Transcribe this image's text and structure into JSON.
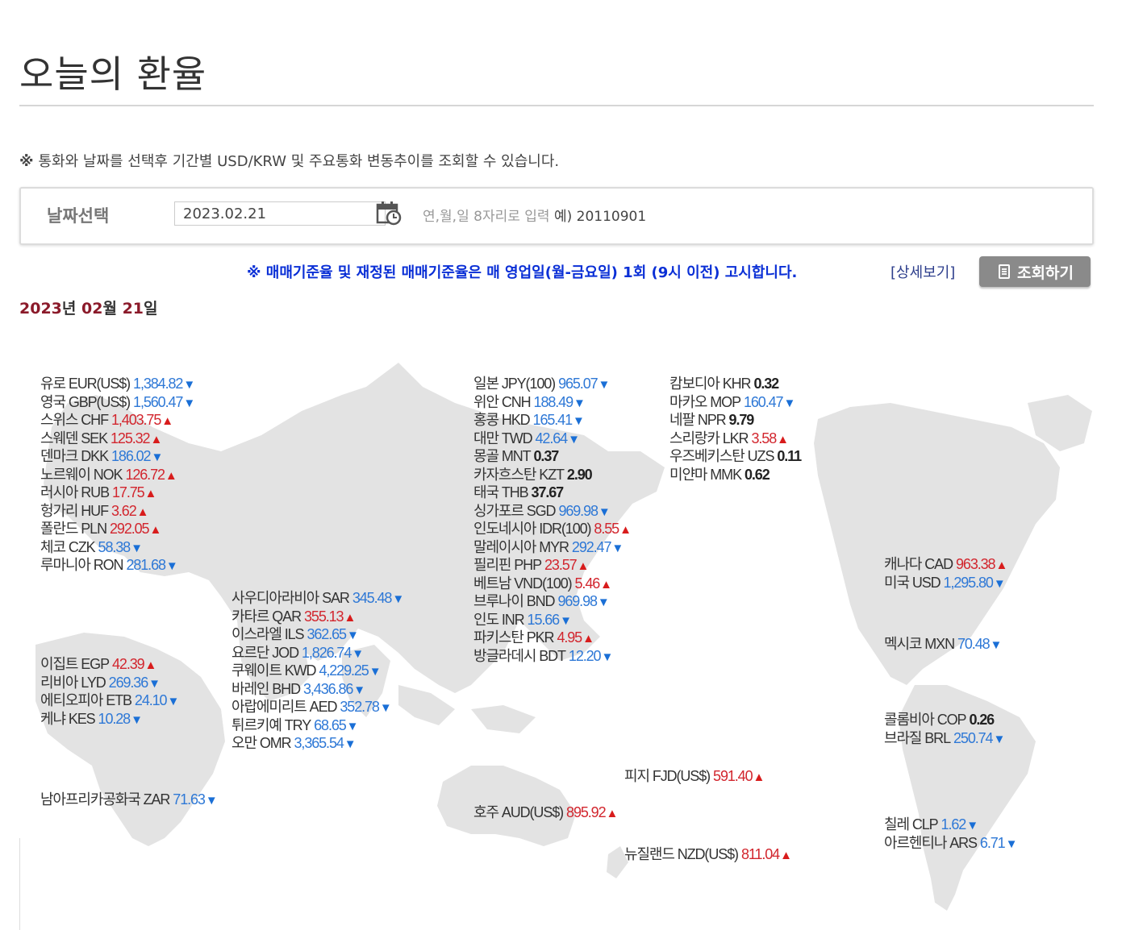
{
  "page": {
    "title": "오늘의 환율",
    "notice_mark": "※",
    "notice": "통화와 날짜를 선택후 기간별 USD/KRW 및 주요통화 변동추이를 조회할 수 있습니다.",
    "date_label": "날짜선택",
    "date_value": "2023.02.21",
    "date_hint": "연,월,일 8자리로 입력",
    "date_hint_example": "예) 20110901",
    "info": "※ 매매기준율 및 재정된 매매기준율은 매 영업일(월-금요일) 1회 (9시 이전) 고시합니다.",
    "detail_link": "[상세보기]",
    "query_button": "조회하기",
    "heading": {
      "year": "2023",
      "y_suffix": "년 ",
      "month": "02",
      "m_suffix": "월 ",
      "day": "21",
      "d_suffix": "일"
    }
  },
  "colors": {
    "up": "#d2262e",
    "down": "#2e78d6",
    "map": "#e3e3e3",
    "heading_num": "#8b1a2a"
  },
  "rates": [
    {
      "label": "유로 EUR(US$)",
      "value": "1,384.82",
      "dir": "down"
    },
    {
      "label": "영국 GBP(US$)",
      "value": "1,560.47",
      "dir": "down"
    },
    {
      "label": "스위스 CHF",
      "value": "1,403.75",
      "dir": "up"
    },
    {
      "label": "스웨덴 SEK",
      "value": "125.32",
      "dir": "up"
    },
    {
      "label": "덴마크 DKK",
      "value": "186.02",
      "dir": "down"
    },
    {
      "label": "노르웨이 NOK",
      "value": "126.72",
      "dir": "up"
    },
    {
      "label": "러시아 RUB",
      "value": "17.75",
      "dir": "up"
    },
    {
      "label": "헝가리 HUF",
      "value": "3.62",
      "dir": "up"
    },
    {
      "label": "폴란드 PLN",
      "value": "292.05",
      "dir": "up"
    },
    {
      "label": "체코 CZK",
      "value": "58.38",
      "dir": "down"
    },
    {
      "label": "루마니아 RON",
      "value": "281.68",
      "dir": "down"
    },
    {
      "label": "이집트 EGP",
      "value": "42.39",
      "dir": "up"
    },
    {
      "label": "리비아 LYD",
      "value": "269.36",
      "dir": "down"
    },
    {
      "label": "에티오피아 ETB",
      "value": "24.10",
      "dir": "down"
    },
    {
      "label": "케냐 KES",
      "value": "10.28",
      "dir": "down"
    },
    {
      "label": "남아프리카공화국 ZAR",
      "value": "71.63",
      "dir": "down"
    },
    {
      "label": "사우디아라비아 SAR",
      "value": "345.48",
      "dir": "down"
    },
    {
      "label": "카타르 QAR",
      "value": "355.13",
      "dir": "up"
    },
    {
      "label": "이스라엘 ILS",
      "value": "362.65",
      "dir": "down"
    },
    {
      "label": "요르단 JOD",
      "value": "1,826.74",
      "dir": "down"
    },
    {
      "label": "쿠웨이트 KWD",
      "value": "4,229.25",
      "dir": "down"
    },
    {
      "label": "바레인 BHD",
      "value": "3,436.86",
      "dir": "down"
    },
    {
      "label": "아랍에미리트 AED",
      "value": "352.78",
      "dir": "down"
    },
    {
      "label": "튀르키예 TRY",
      "value": "68.65",
      "dir": "down"
    },
    {
      "label": "오만 OMR",
      "value": "3,365.54",
      "dir": "down"
    },
    {
      "label": "일본 JPY(100)",
      "value": "965.07",
      "dir": "down"
    },
    {
      "label": "위안 CNH",
      "value": "188.49",
      "dir": "down"
    },
    {
      "label": "홍콩 HKD",
      "value": "165.41",
      "dir": "down"
    },
    {
      "label": "대만 TWD",
      "value": "42.64",
      "dir": "down"
    },
    {
      "label": "몽골 MNT",
      "value": "0.37",
      "dir": "flat"
    },
    {
      "label": "카자흐스탄 KZT",
      "value": "2.90",
      "dir": "flat"
    },
    {
      "label": "태국 THB",
      "value": "37.67",
      "dir": "flat"
    },
    {
      "label": "싱가포르 SGD",
      "value": "969.98",
      "dir": "down"
    },
    {
      "label": "인도네시아 IDR(100)",
      "value": "8.55",
      "dir": "up"
    },
    {
      "label": "말레이시아 MYR",
      "value": "292.47",
      "dir": "down"
    },
    {
      "label": "필리핀 PHP",
      "value": "23.57",
      "dir": "up"
    },
    {
      "label": "베트남 VND(100)",
      "value": "5.46",
      "dir": "up"
    },
    {
      "label": "브루나이 BND",
      "value": "969.98",
      "dir": "down"
    },
    {
      "label": "인도 INR",
      "value": "15.66",
      "dir": "down"
    },
    {
      "label": "파키스탄 PKR",
      "value": "4.95",
      "dir": "up"
    },
    {
      "label": "방글라데시 BDT",
      "value": "12.20",
      "dir": "down"
    },
    {
      "label": "호주 AUD(US$)",
      "value": "895.92",
      "dir": "up"
    },
    {
      "label": "피지 FJD(US$)",
      "value": "591.40",
      "dir": "up"
    },
    {
      "label": "뉴질랜드 NZD(US$)",
      "value": "811.04",
      "dir": "up"
    },
    {
      "label": "캄보디아 KHR",
      "value": "0.32",
      "dir": "flat"
    },
    {
      "label": "마카오 MOP",
      "value": "160.47",
      "dir": "down"
    },
    {
      "label": "네팔 NPR",
      "value": "9.79",
      "dir": "flat"
    },
    {
      "label": "스리랑카 LKR",
      "value": "3.58",
      "dir": "up"
    },
    {
      "label": "우즈베키스탄 UZS",
      "value": "0.11",
      "dir": "flat"
    },
    {
      "label": "미얀마 MMK",
      "value": "0.62",
      "dir": "flat"
    },
    {
      "label": "캐나다 CAD",
      "value": "963.38",
      "dir": "up"
    },
    {
      "label": "미국 USD",
      "value": "1,295.80",
      "dir": "down"
    },
    {
      "label": "멕시코 MXN",
      "value": "70.48",
      "dir": "down"
    },
    {
      "label": "콜롬비아 COP",
      "value": "0.26",
      "dir": "flat"
    },
    {
      "label": "브라질 BRL",
      "value": "250.74",
      "dir": "down"
    },
    {
      "label": "칠레 CLP",
      "value": "1.62",
      "dir": "down"
    },
    {
      "label": "아르헨티나 ARS",
      "value": "6.71",
      "dir": "down"
    }
  ]
}
